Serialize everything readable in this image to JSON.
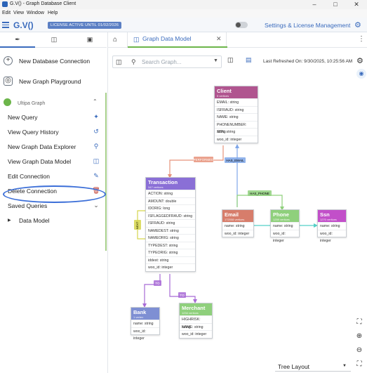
{
  "window": {
    "title": "G.V() - Graph Database Client",
    "minimize_icon": "minimize-icon",
    "maximize_icon": "maximize-icon",
    "close_icon": "close-icon"
  },
  "menubar": {
    "items": [
      "Edit",
      "View",
      "Window",
      "Help"
    ]
  },
  "header": {
    "brand": "G.V()",
    "license_badge": "LICENSE ACTIVE UNTIL 01/02/2026",
    "settings_label": "Settings & License Management"
  },
  "sidebar": {
    "top_actions": [
      {
        "label": "New Database Connection",
        "icon": "plus-icon"
      },
      {
        "label": "New Graph Playground",
        "icon": "playground-icon"
      }
    ],
    "connection": {
      "label": "Ultipa Graph",
      "color": "#6cb54a"
    },
    "items": [
      {
        "label": "New Query",
        "icon": "magic-wand-icon"
      },
      {
        "label": "View Query History",
        "icon": "history-icon"
      },
      {
        "label": "New Graph Data Explorer",
        "icon": "explorer-icon"
      },
      {
        "label": "View Graph Data Model",
        "icon": "database-icon"
      },
      {
        "label": "Edit Connection",
        "icon": "edit-icon"
      },
      {
        "label": "Delete Connection",
        "icon": "trash-icon"
      },
      {
        "label": "Saved Queries",
        "icon": "chevron-down-icon"
      }
    ],
    "subitem": {
      "label": "Data Model"
    },
    "accent": "#3c6fd8"
  },
  "main": {
    "tab_label": "Graph Data Model",
    "search_placeholder": "Search Graph...",
    "last_refreshed": "Last Refreshed On: 9/30/2025, 10:25:56 AM",
    "layout_select": "Tree Layout"
  },
  "graph": {
    "nodes": {
      "client": {
        "name": "Client",
        "count": "5 vertices",
        "color": "#b0558f",
        "props": [
          "EMAIL: string",
          "ISFRAUD: string",
          "NAME: string",
          "PHONENUMBER: string",
          "SSN: string",
          "woo_id: integer"
        ]
      },
      "transaction": {
        "name": "Transaction",
        "count": "347 vertices",
        "color": "#8a6fd6",
        "props": [
          "ACTION: string",
          "AMOUNT: double",
          "IDORIG: long",
          "ISFLAGGEDFRAUD: string",
          "ISFRAUD: string",
          "NAMEDEST: string",
          "NAMEORIG: string",
          "TYPEDEST: string",
          "TYPEORIG: string",
          "iddest: string",
          "woo_id: integer"
        ]
      },
      "email": {
        "name": "Email",
        "count": "172008 vertices",
        "color": "#d77d6b",
        "props": [
          "name: string",
          "woo_id: integer"
        ]
      },
      "phone": {
        "name": "Phone",
        "count": "1259 vertices",
        "color": "#8fd07c",
        "props": [
          "name: string",
          "woo_id: integer"
        ]
      },
      "ssn": {
        "name": "Ssn",
        "count": "1270 vertices",
        "color": "#c24fc9",
        "props": [
          "name: string",
          "woo_id: integer"
        ]
      },
      "bank": {
        "name": "Bank",
        "count": "1 vertex",
        "color": "#7e8fd3",
        "props": [
          "name: string",
          "woo_id: integer"
        ]
      },
      "merchant": {
        "name": "Merchant",
        "count": "1234 vertices",
        "color": "#8fd07c",
        "props": [
          "HIGHRISK: string",
          "NAME: string",
          "woo_id: integer"
        ]
      }
    },
    "edges": {
      "performed": "PERFORMED",
      "has_email": "HAS_EMAIL",
      "has_phone": "HAS_PHONE",
      "next": "NEXT",
      "to_bank": "TO",
      "to_merchant": "TO"
    },
    "edge_colors": {
      "performed": "#e6927a",
      "has_email": "#7ea6e8",
      "has_phone": "#8fd07c",
      "has_ssn": "#55d0c7",
      "next": "#d6d64c",
      "to_bank": "#a86bd6",
      "to_merchant": "#a86bd6"
    }
  }
}
